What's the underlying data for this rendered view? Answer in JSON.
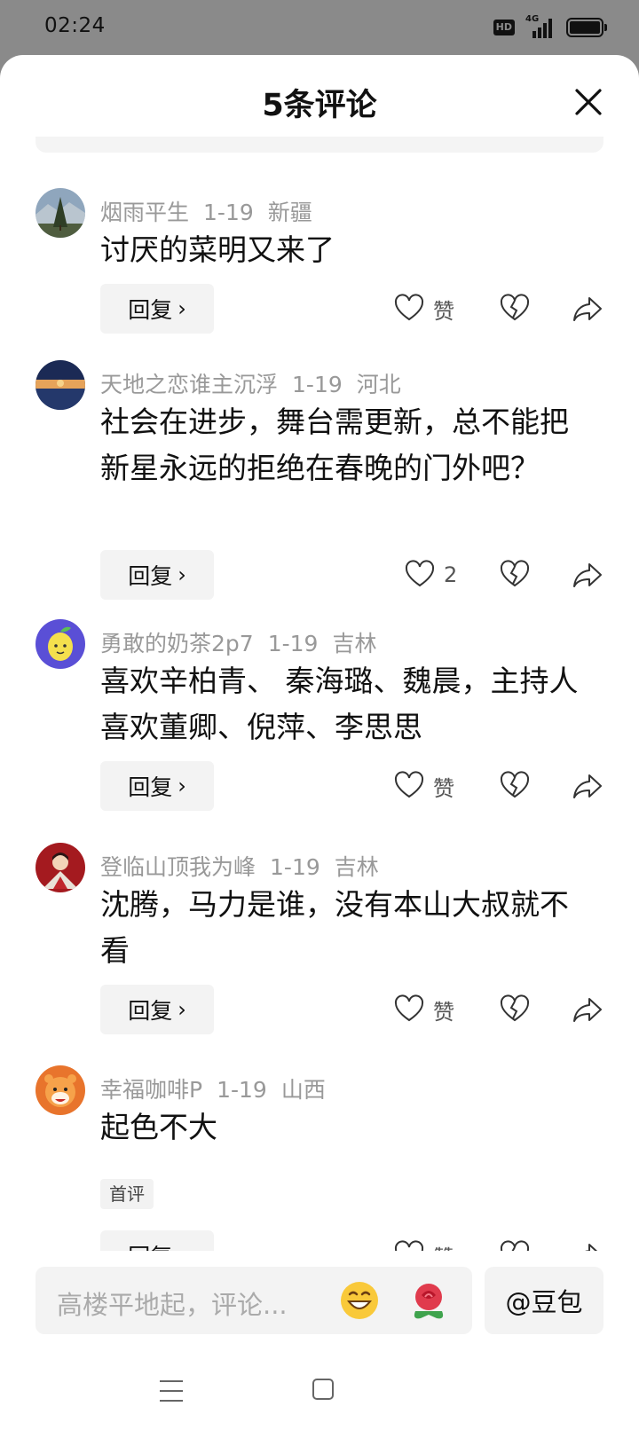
{
  "status_bar": {
    "time": "02:24",
    "hd": "HD",
    "network": "4G",
    "battery_level": 1.0
  },
  "sheet": {
    "title": "5条评论"
  },
  "comments": [
    {
      "user": "烟雨平生",
      "date": "1-19",
      "region": "新疆",
      "text": "讨厌的菜明又来了",
      "reply_label": "回复",
      "like_label": "赞",
      "avatar": "landscape-tree-avatar"
    },
    {
      "user": "天地之恋谁主沉浮",
      "date": "1-19",
      "region": "河北",
      "text": "社会在进步，舞台需更新，总不能把新星永远的拒绝在春晚的门外吧？",
      "reply_label": "回复",
      "like_label": "2",
      "avatar": "sunset-lake-avatar"
    },
    {
      "user": "勇敢的奶茶2p7",
      "date": "1-19",
      "region": "吉林",
      "text": "喜欢辛柏青、 秦海璐、魏晨，主持人喜欢董卿、倪萍、李思思",
      "reply_label": "回复",
      "like_label": "赞",
      "avatar": "lemon-avatar"
    },
    {
      "user": "登临山顶我为峰",
      "date": "1-19",
      "region": "吉林",
      "text": "沈腾，马力是谁，没有本山大叔就不看",
      "reply_label": "回复",
      "like_label": "赞",
      "avatar": "red-cartoon-avatar"
    },
    {
      "user": "幸福咖啡P",
      "date": "1-19",
      "region": "山西",
      "text": "起色不大",
      "badge": "首评",
      "reply_label": "回复",
      "like_label": "赞",
      "avatar": "tiger-avatar"
    }
  ],
  "input": {
    "placeholder": "高楼平地起，评论...",
    "at_label": "@豆包"
  },
  "colors": {
    "meta": "#999999",
    "text": "#111111",
    "button_bg": "#f3f3f3",
    "status_bg": "#8a8a8a"
  }
}
